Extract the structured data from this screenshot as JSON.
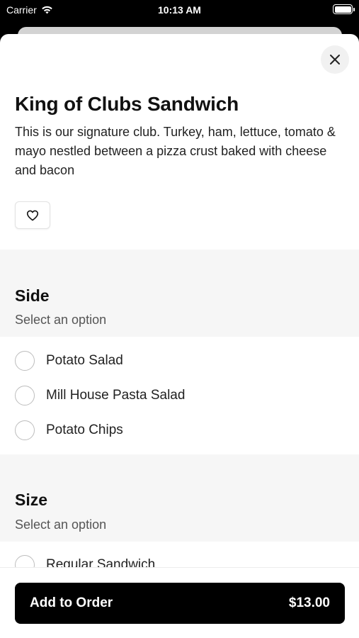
{
  "status_bar": {
    "carrier": "Carrier",
    "time": "10:13 AM"
  },
  "item": {
    "title": "King of Clubs Sandwich",
    "description": "This is our signature club. Turkey, ham, lettuce, tomato & mayo nestled between a pizza crust baked with cheese and bacon"
  },
  "sections": [
    {
      "title": "Side",
      "subtitle": "Select an option",
      "options": [
        "Potato Salad",
        "Mill House Pasta Salad",
        "Potato Chips"
      ]
    },
    {
      "title": "Size",
      "subtitle": "Select an option",
      "options": [
        "Regular Sandwich"
      ]
    }
  ],
  "footer": {
    "button_label": "Add to Order",
    "price": "$13.00"
  },
  "icons": {
    "close": "close-icon",
    "favorite": "heart-icon",
    "wifi": "wifi-icon",
    "battery": "battery-icon"
  }
}
